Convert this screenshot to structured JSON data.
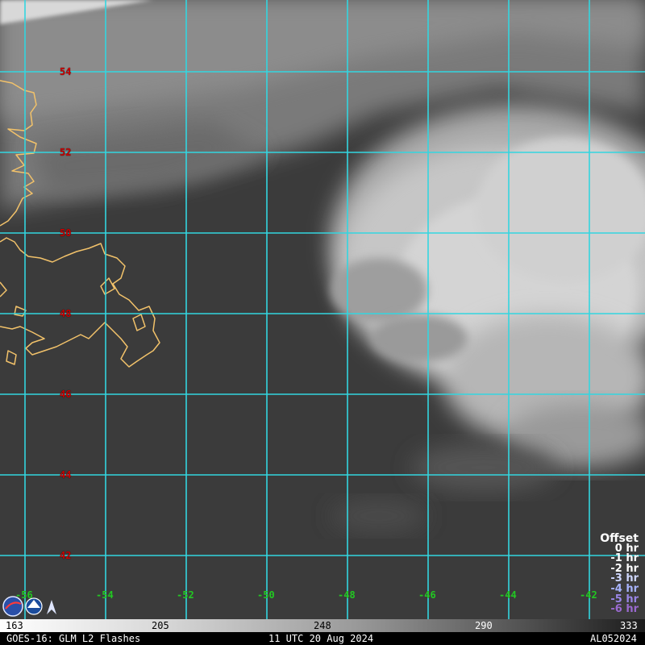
{
  "map": {
    "lat_labels": [
      "54",
      "52",
      "50",
      "48",
      "46",
      "44",
      "42"
    ],
    "lon_labels": [
      "-56",
      "-54",
      "-52",
      "-50",
      "-48",
      "-46",
      "-44",
      "-42"
    ],
    "grid_color": "#33d6e0",
    "coastline_color": "#f2c26a",
    "lat_label_color": "#c80000",
    "lon_label_color": "#22c822"
  },
  "legend": {
    "title": "Offset",
    "entries": [
      {
        "label": "0 hr",
        "color": "#ffffff"
      },
      {
        "label": "-1 hr",
        "color": "#ffffff"
      },
      {
        "label": "-2 hr",
        "color": "#ffffff"
      },
      {
        "label": "-3 hr",
        "color": "#d0d8ff"
      },
      {
        "label": "-4 hr",
        "color": "#a8b4ff"
      },
      {
        "label": "-5 hr",
        "color": "#9a86e8"
      },
      {
        "label": "-6 hr",
        "color": "#9a6ad0"
      }
    ]
  },
  "colorbar": {
    "ticks": [
      "163",
      "205",
      "248",
      "290",
      "333"
    ]
  },
  "footer": {
    "left": "GOES-16: GLM L2 Flashes",
    "center": "11 UTC 20 Aug 2024",
    "right": "AL052024"
  }
}
